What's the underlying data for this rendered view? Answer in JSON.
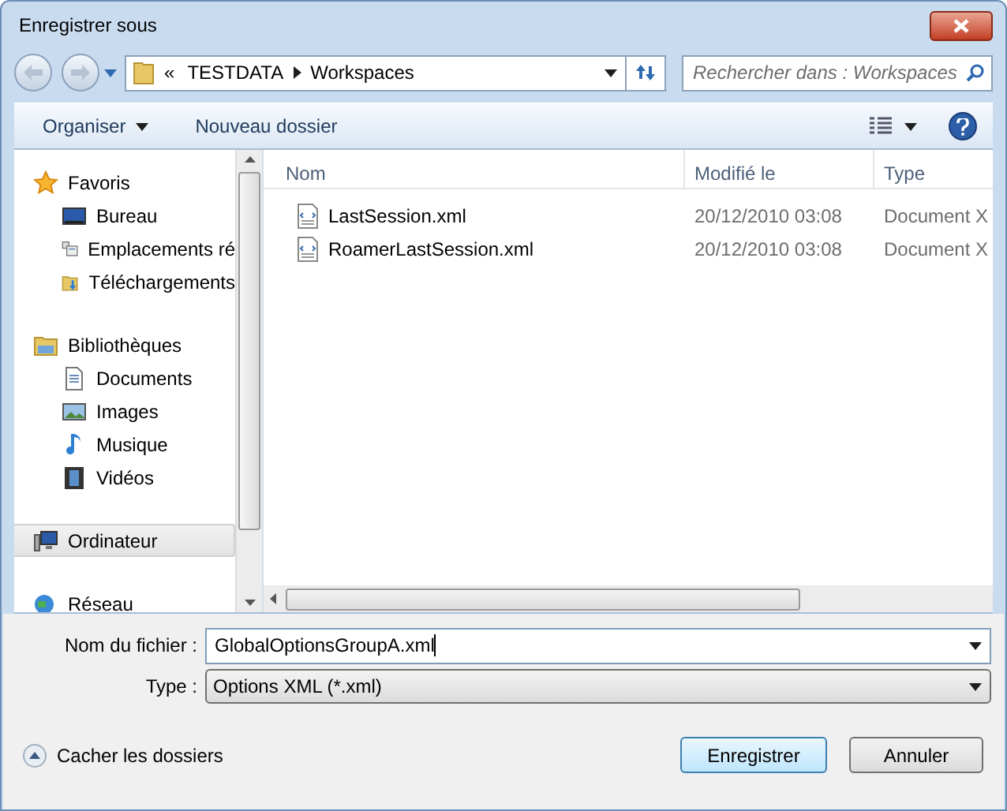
{
  "window": {
    "title": "Enregistrer sous"
  },
  "address": {
    "overflow": "«",
    "crumbs": [
      "TESTDATA",
      "Workspaces"
    ]
  },
  "search": {
    "placeholder": "Rechercher dans : Workspaces"
  },
  "toolbar": {
    "organize": "Organiser",
    "new_folder": "Nouveau dossier"
  },
  "sidebar": {
    "groups": [
      {
        "label": "Favoris",
        "kind": "star",
        "selected": false,
        "children": [
          {
            "label": "Bureau",
            "kind": "desktop"
          },
          {
            "label": "Emplacements ré",
            "kind": "places"
          },
          {
            "label": "Téléchargements",
            "kind": "downloads"
          }
        ]
      },
      {
        "label": "Bibliothèques",
        "kind": "library",
        "selected": false,
        "children": [
          {
            "label": "Documents",
            "kind": "document"
          },
          {
            "label": "Images",
            "kind": "image"
          },
          {
            "label": "Musique",
            "kind": "music"
          },
          {
            "label": "Vidéos",
            "kind": "video"
          }
        ]
      },
      {
        "label": "Ordinateur",
        "kind": "computer",
        "selected": true
      },
      {
        "label": "Réseau",
        "kind": "network",
        "selected": false
      }
    ]
  },
  "table": {
    "columns": [
      "Nom",
      "Modifié le",
      "Type"
    ],
    "rows": [
      {
        "name": "LastSession.xml",
        "modified": "20/12/2010 03:08",
        "type": "Document X"
      },
      {
        "name": "RoamerLastSession.xml",
        "modified": "20/12/2010 03:08",
        "type": "Document X"
      }
    ]
  },
  "form": {
    "filename_label": "Nom du fichier :",
    "filename": "GlobalOptionsGroupA.xml",
    "type_label": "Type :",
    "type": "Options XML (*.xml)"
  },
  "hide_folders": "Cacher les dossiers",
  "buttons": {
    "save": "Enregistrer",
    "cancel": "Annuler"
  }
}
